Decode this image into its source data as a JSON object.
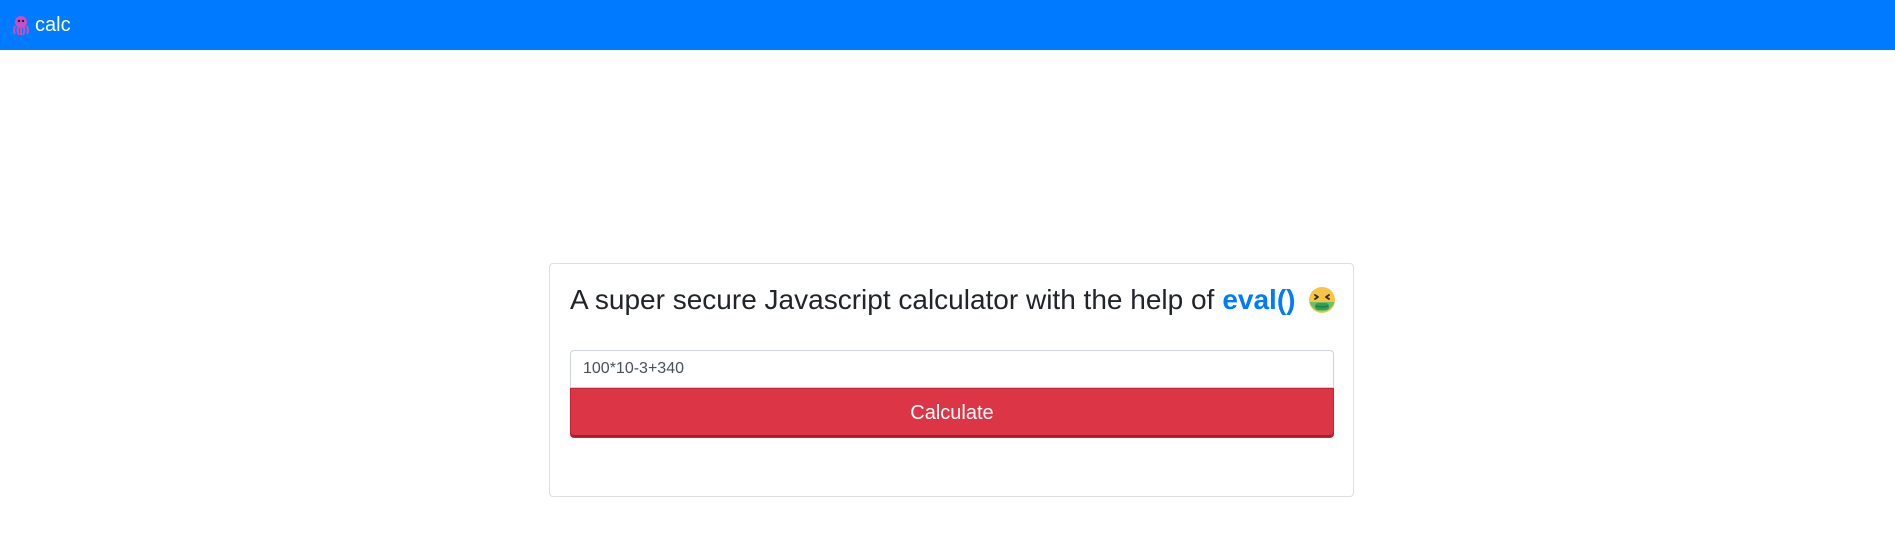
{
  "navbar": {
    "brand_label": "calc",
    "brand_icon": "octopus-icon",
    "background_color": "#007bff"
  },
  "card": {
    "title_text": "A super secure Javascript calculator with the help of",
    "title_link_text": "eval()",
    "title_emoji": "nauseated-face-icon",
    "link_color": "#007bff"
  },
  "form": {
    "expression_value": "100*10-3+340",
    "calculate_label": "Calculate",
    "button_color": "#dc3545"
  }
}
